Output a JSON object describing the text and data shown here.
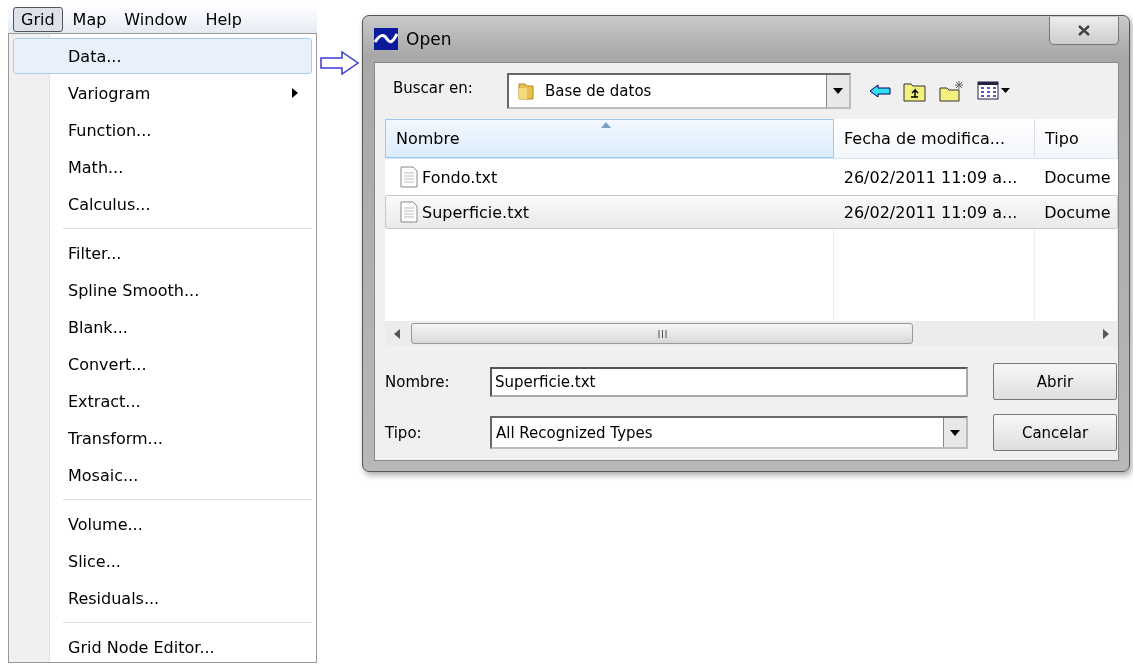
{
  "menu_bar": [
    {
      "label": "Grid",
      "selected": true
    },
    {
      "label": "Map",
      "selected": false
    },
    {
      "label": "Window",
      "selected": false
    },
    {
      "label": "Help",
      "selected": false
    }
  ],
  "menu_items": [
    {
      "kind": "item",
      "label": "Data...",
      "selected": true,
      "submenu": false
    },
    {
      "kind": "item",
      "label": "Variogram",
      "selected": false,
      "submenu": true
    },
    {
      "kind": "item",
      "label": "Function...",
      "selected": false,
      "submenu": false
    },
    {
      "kind": "item",
      "label": "Math...",
      "selected": false,
      "submenu": false
    },
    {
      "kind": "item",
      "label": "Calculus...",
      "selected": false,
      "submenu": false
    },
    {
      "kind": "separator"
    },
    {
      "kind": "item",
      "label": "Filter...",
      "selected": false,
      "submenu": false
    },
    {
      "kind": "item",
      "label": "Spline Smooth...",
      "selected": false,
      "submenu": false
    },
    {
      "kind": "item",
      "label": "Blank...",
      "selected": false,
      "submenu": false
    },
    {
      "kind": "item",
      "label": "Convert...",
      "selected": false,
      "submenu": false
    },
    {
      "kind": "item",
      "label": "Extract...",
      "selected": false,
      "submenu": false
    },
    {
      "kind": "item",
      "label": "Transform...",
      "selected": false,
      "submenu": false
    },
    {
      "kind": "item",
      "label": "Mosaic...",
      "selected": false,
      "submenu": false
    },
    {
      "kind": "separator"
    },
    {
      "kind": "item",
      "label": "Volume...",
      "selected": false,
      "submenu": false
    },
    {
      "kind": "item",
      "label": "Slice...",
      "selected": false,
      "submenu": false
    },
    {
      "kind": "item",
      "label": "Residuals...",
      "selected": false,
      "submenu": false
    },
    {
      "kind": "separator"
    },
    {
      "kind": "item",
      "label": "Grid Node Editor...",
      "selected": false,
      "submenu": false
    }
  ],
  "dialog": {
    "title": "Open",
    "look_in": {
      "label": "Buscar en:",
      "value": "Base de datos"
    },
    "columns": [
      {
        "label": "Nombre",
        "sorted": true
      },
      {
        "label": "Fecha de modifica...",
        "sorted": false
      },
      {
        "label": "Tipo",
        "sorted": false
      }
    ],
    "files": [
      {
        "name": "Fondo.txt",
        "date": "26/02/2011 11:09 a...",
        "type": "Docume",
        "selected": false
      },
      {
        "name": "Superficie.txt",
        "date": "26/02/2011 11:09 a...",
        "type": "Docume",
        "selected": true
      }
    ],
    "file_name": {
      "label": "Nombre:",
      "value": "Superficie.txt"
    },
    "file_type": {
      "label": "Tipo:",
      "value": "All Recognized Types"
    },
    "buttons": [
      "Abrir",
      "Cancelar"
    ]
  }
}
